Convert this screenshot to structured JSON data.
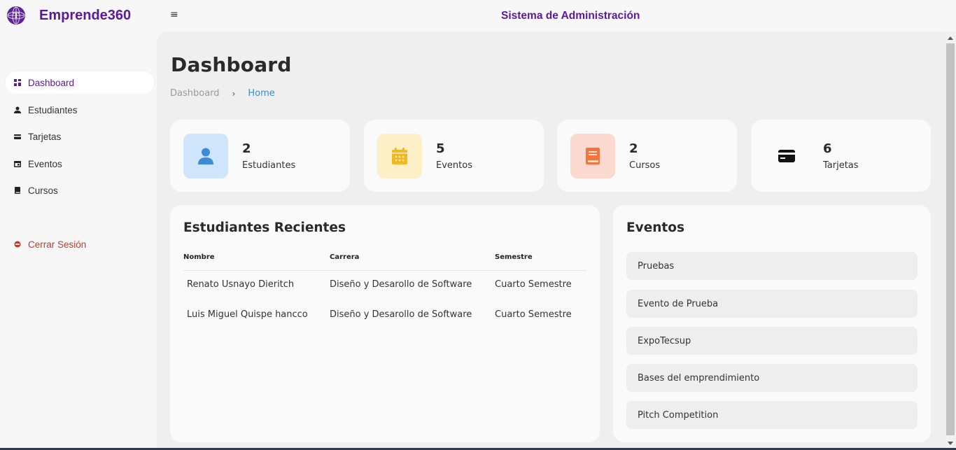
{
  "header": {
    "brand": "Emprende360",
    "title": "Sistema de Administración"
  },
  "sidebar": {
    "items": [
      {
        "label": "Dashboard",
        "icon": "grid-icon",
        "active": true
      },
      {
        "label": "Estudiantes",
        "icon": "user-icon"
      },
      {
        "label": "Tarjetas",
        "icon": "card-icon"
      },
      {
        "label": "Eventos",
        "icon": "calendar-icon"
      },
      {
        "label": "Cursos",
        "icon": "book-icon"
      }
    ],
    "logout": {
      "label": "Cerrar Sesión",
      "icon": "logout-icon"
    }
  },
  "main": {
    "title": "Dashboard",
    "breadcrumb": {
      "first": "Dashboard",
      "separator": "›",
      "current": "Home"
    }
  },
  "stats": [
    {
      "value": "2",
      "label": "Estudiantes",
      "icon": "user-icon",
      "bg": "#cfe5fb",
      "color": "#3d8bd4"
    },
    {
      "value": "5",
      "label": "Eventos",
      "icon": "calendar-icon",
      "bg": "#fdefc6",
      "color": "#f2b824"
    },
    {
      "value": "2",
      "label": "Cursos",
      "icon": "book-icon",
      "bg": "#fcd9cf",
      "color": "#f2763c"
    },
    {
      "value": "6",
      "label": "Tarjetas",
      "icon": "card-icon",
      "bg": "#fafafa",
      "color": "#111111"
    }
  ],
  "recent_students": {
    "title": "Estudiantes Recientes",
    "columns": [
      "Nombre",
      "Carrera",
      "Semestre"
    ],
    "rows": [
      [
        "Renato Usnayo Dieritch",
        "Diseño y Desarollo de Software",
        "Cuarto Semestre"
      ],
      [
        "Luis Miguel Quispe hancco",
        "Diseño y Desarollo de Software",
        "Cuarto Semestre"
      ]
    ]
  },
  "events": {
    "title": "Eventos",
    "items": [
      "Pruebas",
      "Evento de Prueba",
      "ExpoTecsup",
      "Bases del emprendimiento",
      "Pitch Competition"
    ]
  },
  "colors": {
    "brand": "#5b1a9b",
    "link": "#3d8bd4",
    "danger": "#c0392b"
  }
}
